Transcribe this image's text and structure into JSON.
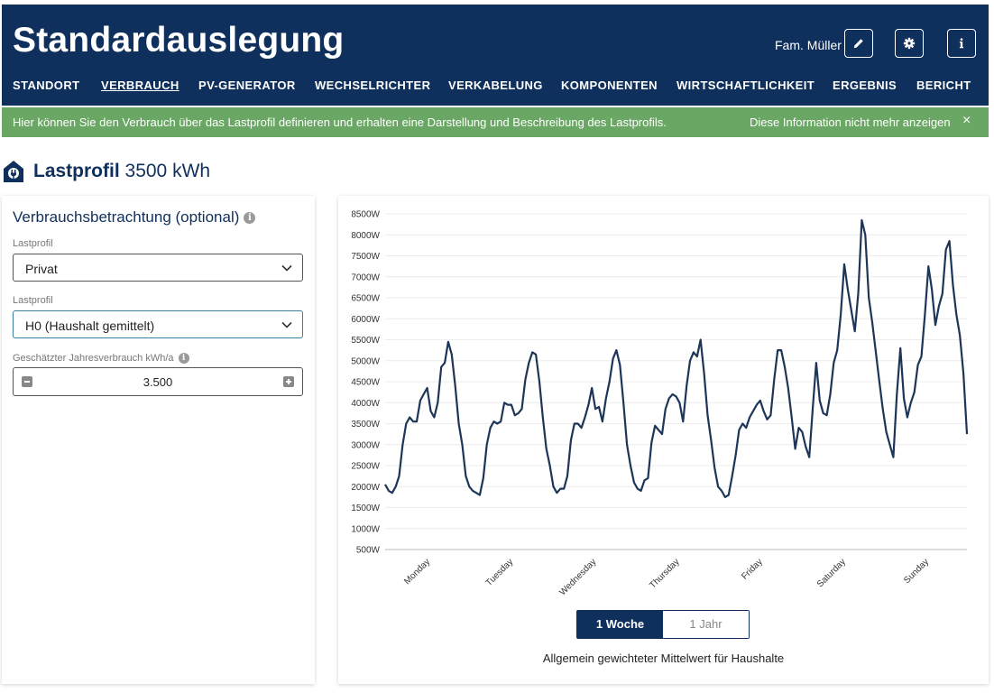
{
  "header": {
    "title": "Standardauslegung",
    "user_name": "Fam. Müller",
    "edit_icon": "pencil-icon",
    "settings_icon": "gear-icon",
    "info_icon": "info-icon"
  },
  "nav": {
    "items": [
      "STANDORT",
      "VERBRAUCH",
      "PV-GENERATOR",
      "WECHSELRICHTER",
      "VERKABELUNG",
      "KOMPONENTEN",
      "WIRTSCHAFTLICHKEIT",
      "ERGEBNIS",
      "BERICHT"
    ],
    "active": "VERBRAUCH"
  },
  "infobar": {
    "text": "Hier können Sie den Verbrauch über das Lastprofil definieren und erhalten eine Darstellung und Beschreibung des Lastprofils.",
    "dismiss": "Diese Information nicht mehr anzeigen",
    "close": "×",
    "color": "#6aa764"
  },
  "section": {
    "title_bold": "Lastprofil",
    "title_rest": "3500 kWh",
    "icon": "house-plug-icon"
  },
  "left_panel": {
    "heading": "Verbrauchsbetrachtung (optional)",
    "help_symbol": "i",
    "profile_type_label": "Lastprofil",
    "profile_type_value": "Privat",
    "profile_label": "Lastprofil",
    "profile_value": "H0 (Haushalt gemittelt)",
    "consumption_label": "Geschätzter Jahresverbrauch kWh/a",
    "consumption_value": "3.500"
  },
  "chart_panel": {
    "toggle": {
      "week": "1 Woche",
      "year": "1 Jahr",
      "active": "1 Woche"
    },
    "caption": "Allgemein gewichteter Mittelwert für Haushalte"
  },
  "colors": {
    "primary": "#0f2f5c",
    "success": "#6aa764",
    "line": "#1d3557"
  },
  "chart_data": {
    "type": "line",
    "title": "",
    "xlabel": "",
    "ylabel": "",
    "ylim": [
      500,
      8500
    ],
    "yticks": [
      "500W",
      "1000W",
      "1500W",
      "2000W",
      "2500W",
      "3000W",
      "3500W",
      "4000W",
      "4500W",
      "5000W",
      "5500W",
      "6000W",
      "6500W",
      "7000W",
      "7500W",
      "8000W",
      "8500W"
    ],
    "x_categories": [
      "Monday",
      "Tuesday",
      "Wednesday",
      "Thursday",
      "Friday",
      "Saturday",
      "Sunday"
    ],
    "grid": true,
    "series": [
      {
        "values": [
          2050,
          1900,
          1850,
          2000,
          2250,
          3000,
          3500,
          3650,
          3550,
          3550,
          4050,
          4200,
          4350,
          3800,
          3650,
          4000,
          4850,
          4950,
          5450,
          5150,
          4400,
          3500,
          3000,
          2250,
          2000,
          1900,
          1850,
          1800,
          2200,
          3000,
          3400,
          3550,
          3500,
          3550,
          4000,
          3950,
          3950,
          3700,
          3750,
          3850,
          4550,
          4950,
          5200,
          5150,
          4500,
          3650,
          2900,
          2500,
          2000,
          1850,
          1950,
          1950,
          2250,
          3100,
          3500,
          3500,
          3400,
          3650,
          3950,
          4350,
          3850,
          3900,
          3550,
          4100,
          4500,
          5050,
          5250,
          4900,
          4000,
          3000,
          2500,
          2100,
          1950,
          1900,
          2150,
          2200,
          3050,
          3450,
          3350,
          3250,
          3850,
          4100,
          4200,
          4150,
          4000,
          3550,
          4400,
          5000,
          5200,
          5100,
          5500,
          4700,
          3700,
          3100,
          2450,
          2000,
          1900,
          1750,
          1800,
          2250,
          2750,
          3350,
          3500,
          3400,
          3650,
          3800,
          3950,
          4050,
          3800,
          3600,
          3700,
          4550,
          5250,
          5250,
          4850,
          4350,
          3650,
          2900,
          3400,
          3300,
          2950,
          2700,
          3850,
          4950,
          4050,
          3750,
          3700,
          4200,
          4950,
          5250,
          6100,
          7300,
          6700,
          6200,
          5700,
          6600,
          8350,
          8000,
          6500,
          5900,
          5200,
          4500,
          3850,
          3300,
          3000,
          2700,
          4200,
          5300,
          4100,
          3650,
          4000,
          4250,
          4900,
          5100,
          6100,
          7250,
          6700,
          5850,
          6300,
          6600,
          7650,
          7850,
          6800,
          6100,
          5600,
          4700,
          3250
        ]
      }
    ]
  }
}
